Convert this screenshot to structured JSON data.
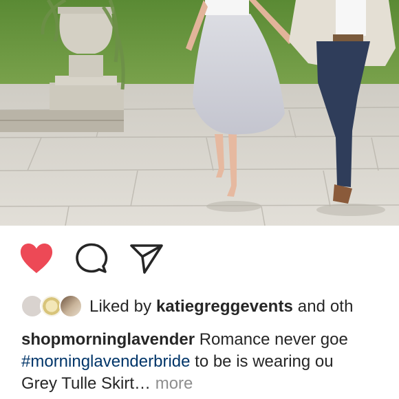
{
  "post": {
    "actions": {
      "like_icon": "heart-filled-icon",
      "comment_icon": "comment-bubble-icon",
      "share_icon": "paper-plane-icon",
      "like_color": "#ed4956"
    },
    "likes": {
      "prefix": "Liked by ",
      "user": "katiegreggevents",
      "suffix": " and oth"
    },
    "caption": {
      "username": "shopmorninglavender",
      "line1_text": " Romance never goe",
      "hashtag": "#morninglavenderbride",
      "line2_text": " to be is wearing ou",
      "line3_text": "Grey Tulle Skirt…",
      "more_label": " more"
    }
  }
}
